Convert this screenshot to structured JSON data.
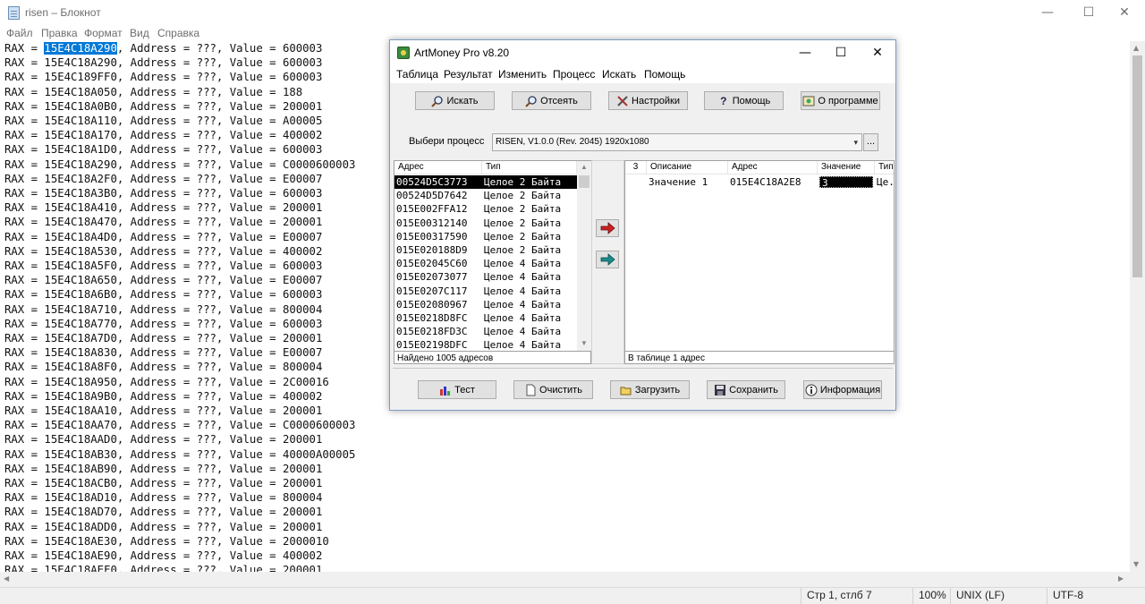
{
  "notepad": {
    "title": "risen – Блокнот",
    "menu": [
      "Файл",
      "Правка",
      "Формат",
      "Вид",
      "Справка"
    ],
    "first_line": {
      "prefix": "RAX = ",
      "selected": "15E4C18A290",
      "suffix": ", Address = ???, Value = 600003"
    },
    "lines": [
      "RAX = 15E4C18A290, Address = ???, Value = 600003",
      "RAX = 15E4C189FF0, Address = ???, Value = 600003",
      "RAX = 15E4C18A050, Address = ???, Value = 188",
      "RAX = 15E4C18A0B0, Address = ???, Value = 200001",
      "RAX = 15E4C18A110, Address = ???, Value = A00005",
      "RAX = 15E4C18A170, Address = ???, Value = 400002",
      "RAX = 15E4C18A1D0, Address = ???, Value = 600003",
      "RAX = 15E4C18A290, Address = ???, Value = C0000600003",
      "RAX = 15E4C18A2F0, Address = ???, Value = E00007",
      "RAX = 15E4C18A3B0, Address = ???, Value = 600003",
      "RAX = 15E4C18A410, Address = ???, Value = 200001",
      "RAX = 15E4C18A470, Address = ???, Value = 200001",
      "RAX = 15E4C18A4D0, Address = ???, Value = E00007",
      "RAX = 15E4C18A530, Address = ???, Value = 400002",
      "RAX = 15E4C18A5F0, Address = ???, Value = 600003",
      "RAX = 15E4C18A650, Address = ???, Value = E00007",
      "RAX = 15E4C18A6B0, Address = ???, Value = 600003",
      "RAX = 15E4C18A710, Address = ???, Value = 800004",
      "RAX = 15E4C18A770, Address = ???, Value = 600003",
      "RAX = 15E4C18A7D0, Address = ???, Value = 200001",
      "RAX = 15E4C18A830, Address = ???, Value = E00007",
      "RAX = 15E4C18A8F0, Address = ???, Value = 800004",
      "RAX = 15E4C18A950, Address = ???, Value = 2C00016",
      "RAX = 15E4C18A9B0, Address = ???, Value = 400002",
      "RAX = 15E4C18AA10, Address = ???, Value = 200001",
      "RAX = 15E4C18AA70, Address = ???, Value = C0000600003",
      "RAX = 15E4C18AAD0, Address = ???, Value = 200001",
      "RAX = 15E4C18AB30, Address = ???, Value = 40000A00005",
      "RAX = 15E4C18AB90, Address = ???, Value = 200001",
      "RAX = 15E4C18ACB0, Address = ???, Value = 200001",
      "RAX = 15E4C18AD10, Address = ???, Value = 800004",
      "RAX = 15E4C18AD70, Address = ???, Value = 200001",
      "RAX = 15E4C18ADD0, Address = ???, Value = 200001",
      "RAX = 15E4C18AE30, Address = ???, Value = 2000010",
      "RAX = 15E4C18AE90, Address = ???, Value = 400002",
      "RAX = 15E4C18AEF0, Address = ???, Value = 200001"
    ],
    "status": {
      "position": "Стр 1, стлб 7",
      "zoom": "100%",
      "line_ending": "UNIX (LF)",
      "encoding": "UTF-8"
    }
  },
  "artmoney": {
    "title": "ArtMoney Pro v8.20",
    "menu": [
      "Таблица",
      "Результат",
      "Изменить",
      "Процесс",
      "Искать",
      "Помощь"
    ],
    "top_buttons": [
      "Искать",
      "Отсеять",
      "Настройки",
      "Помощь",
      "О программе"
    ],
    "process_label": "Выбери процесс",
    "process_value": "RISEN, V1.0.0 (Rev. 2045) 1920x1080",
    "ellipsis": "...",
    "left_table": {
      "headers": [
        "Адрес",
        "Тип"
      ],
      "rows": [
        [
          "00524D5C3773",
          "Целое 2 Байта"
        ],
        [
          "00524D5D7642",
          "Целое 2 Байта"
        ],
        [
          "015E002FFA12",
          "Целое 2 Байта"
        ],
        [
          "015E00312140",
          "Целое 2 Байта"
        ],
        [
          "015E00317590",
          "Целое 2 Байта"
        ],
        [
          "015E020188D9",
          "Целое 2 Байта"
        ],
        [
          "015E02045C60",
          "Целое 4 Байта"
        ],
        [
          "015E02073077",
          "Целое 4 Байта"
        ],
        [
          "015E0207C117",
          "Целое 4 Байта"
        ],
        [
          "015E02080967",
          "Целое 4 Байта"
        ],
        [
          "015E0218D8FC",
          "Целое 4 Байта"
        ],
        [
          "015E0218FD3C",
          "Целое 4 Байта"
        ],
        [
          "015E02198DFC",
          "Целое 4 Байта"
        ]
      ],
      "status": "Найдено 1005 адресов"
    },
    "right_table": {
      "headers": [
        "3",
        "Описание",
        "Адрес",
        "Значение",
        "Тип"
      ],
      "rows": [
        [
          "",
          "Значение 1",
          "015E4C18A2E8",
          "3",
          "Це."
        ]
      ],
      "status": "В таблице 1 адрес"
    },
    "bottom_buttons": [
      "Тест",
      "Очистить",
      "Загрузить",
      "Сохранить",
      "Информация"
    ]
  },
  "colors": {
    "selection": "#0078d7",
    "arrow_right": "#d02020",
    "arrow_left": "#1a8a8a"
  }
}
